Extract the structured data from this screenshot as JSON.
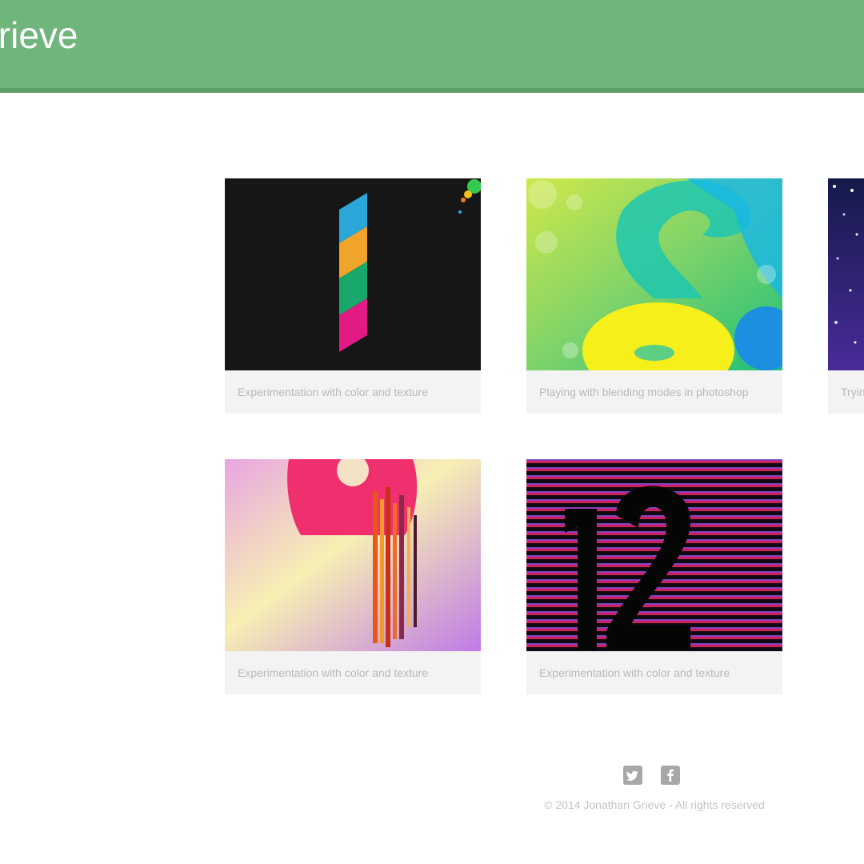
{
  "header": {
    "title": "Grieve",
    "background": "#6fb57c"
  },
  "portfolio": {
    "items": [
      {
        "caption": "Experimentation with color and texture",
        "art": "striped-one-artwork"
      },
      {
        "caption": "Playing with blending modes in photoshop",
        "art": "blend-eight-artwork"
      },
      {
        "caption": "Tryin",
        "art": "starfield-artwork"
      },
      {
        "caption": "Experimentation with color and texture",
        "art": "drip-nine-artwork"
      },
      {
        "caption": "Experimentation with color and texture",
        "art": "stripes-twelve-artwork"
      }
    ]
  },
  "footer": {
    "social": [
      {
        "icon": "twitter-icon",
        "glyph": "🐦"
      },
      {
        "icon": "facebook-icon",
        "glyph": "f"
      }
    ],
    "copyright": "© 2014 Jonathan Grieve - All rights reserved"
  }
}
